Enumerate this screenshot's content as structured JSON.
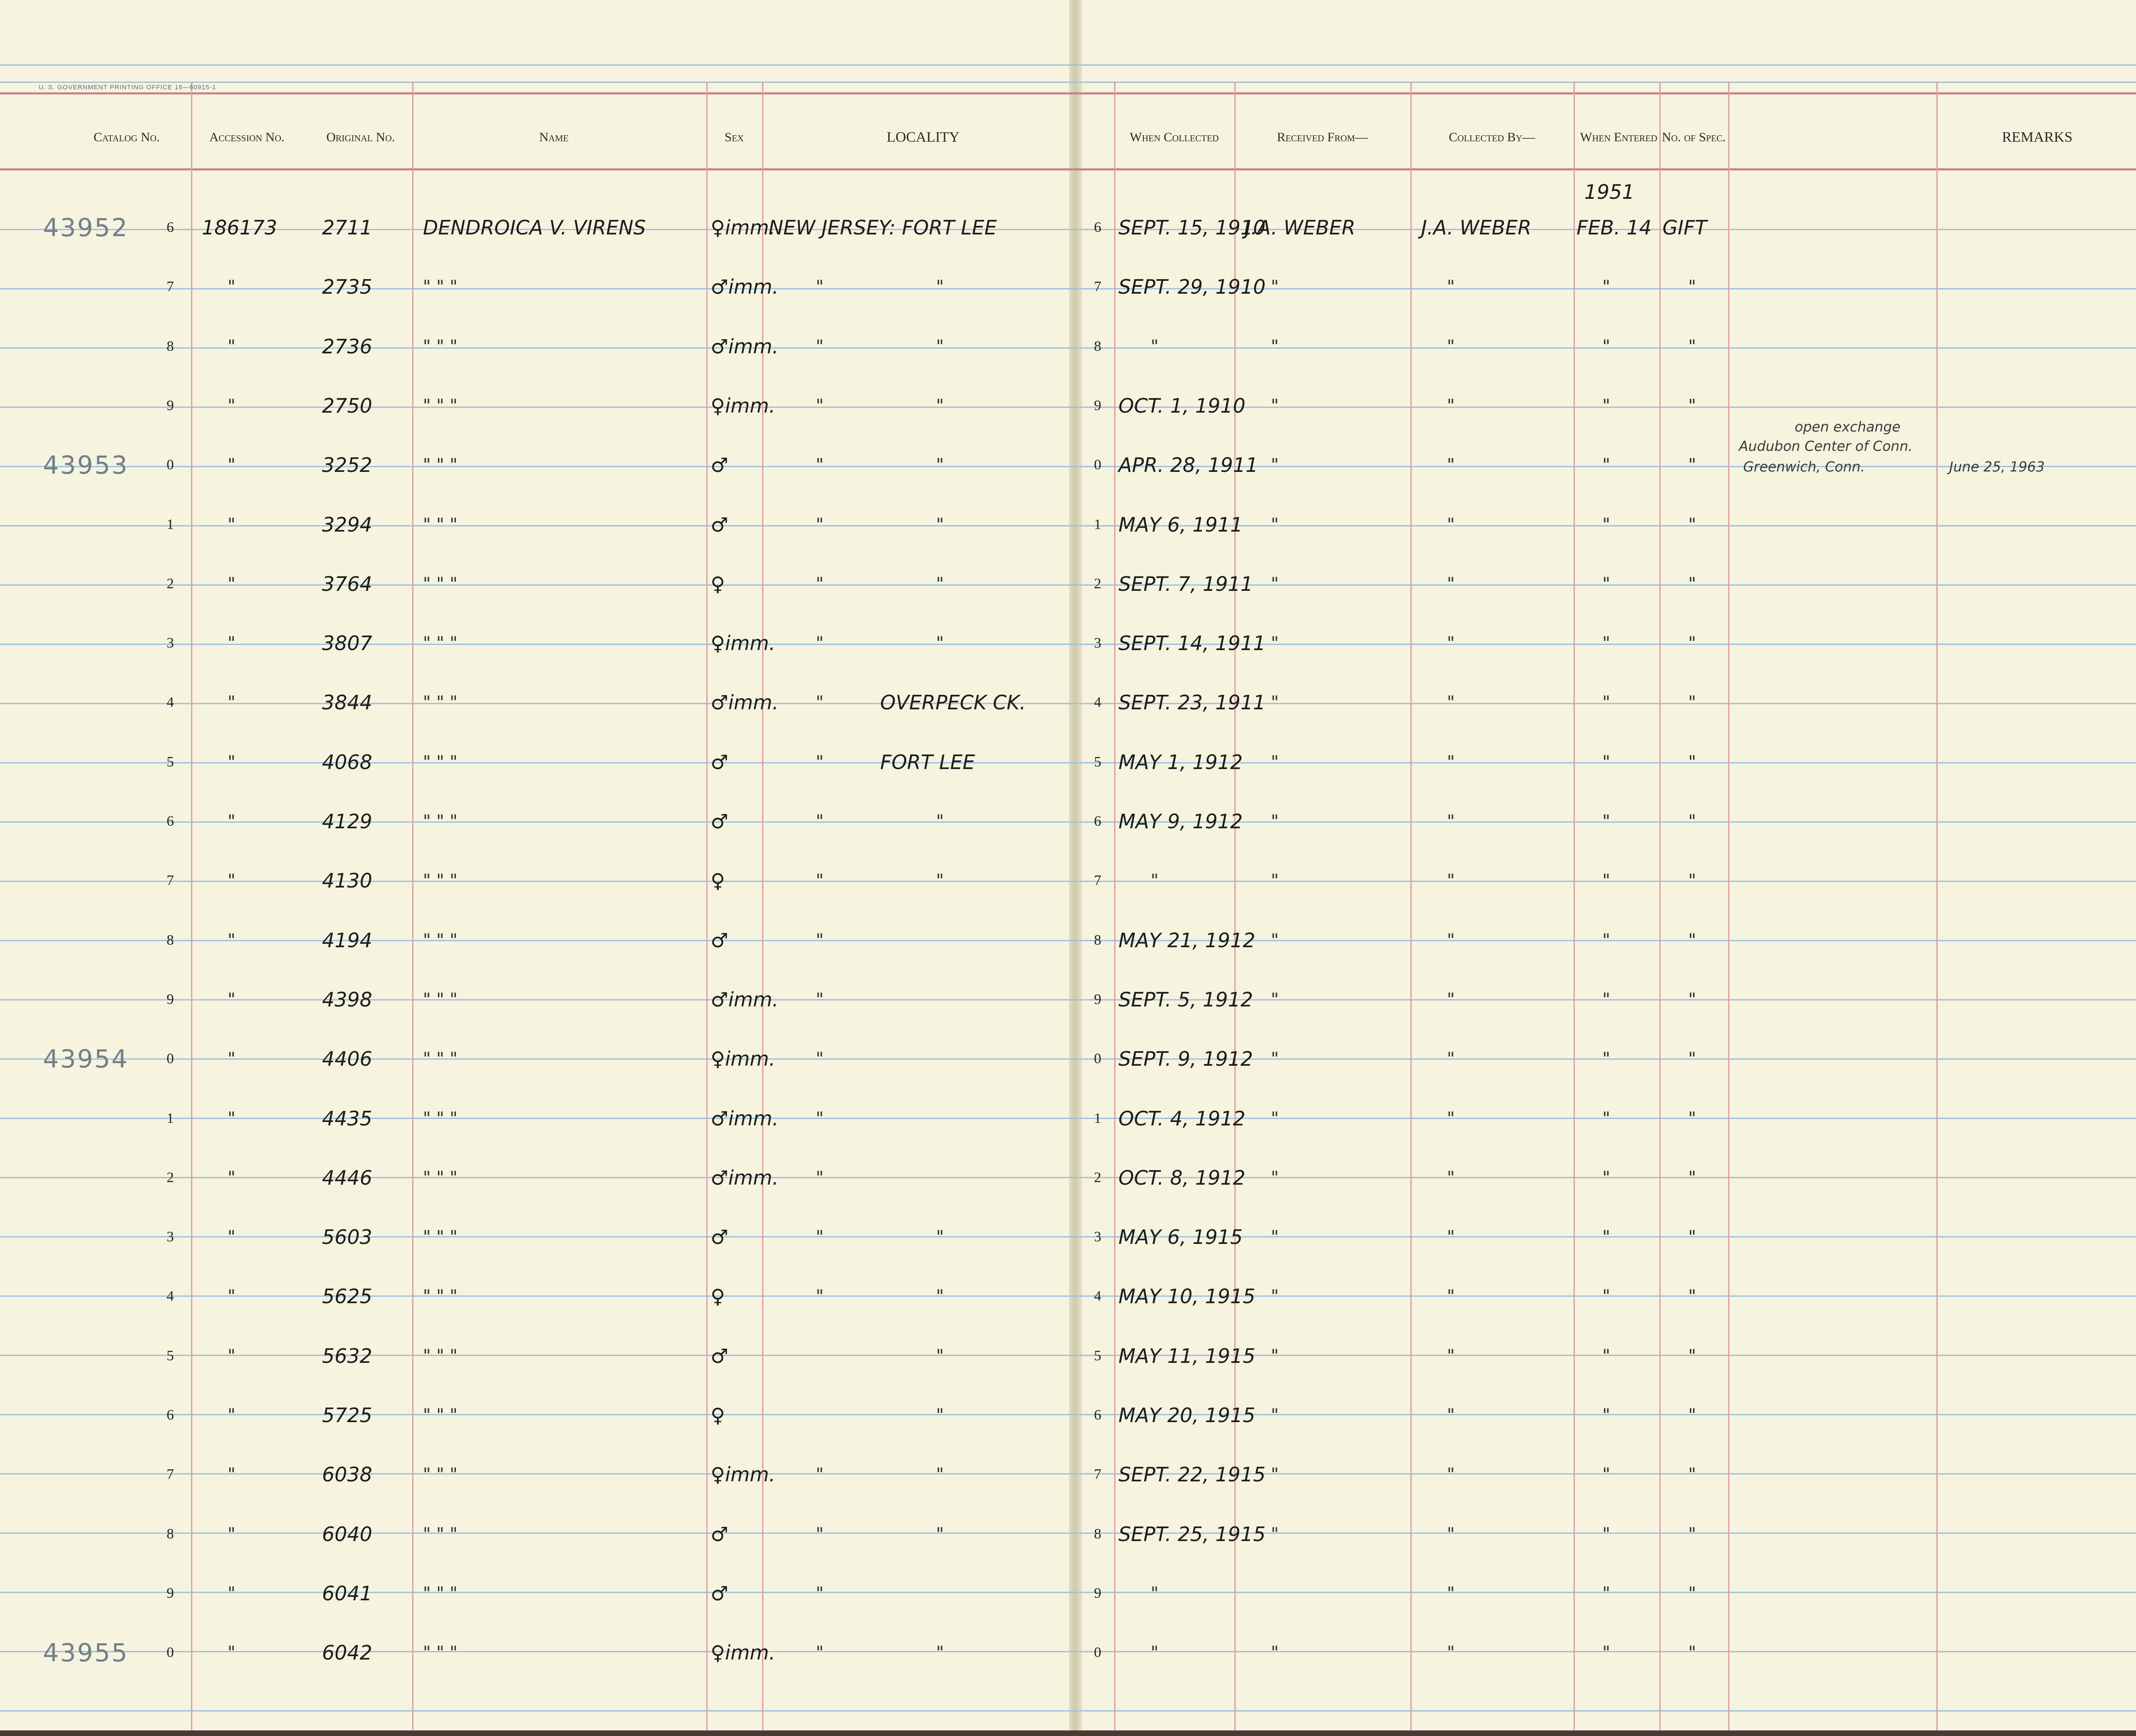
{
  "printer_line": "U. S. GOVERNMENT PRINTING OFFICE    16—60915-1",
  "headers": {
    "catalog_no": "Catalog No.",
    "accession_no": "Accession No.",
    "original_no": "Original No.",
    "name": "Name",
    "sex": "Sex",
    "locality": "LOCALITY",
    "when_collected": "When Collected",
    "received_from": "Received From—",
    "collected_by": "Collected By—",
    "when_entered": "When Entered",
    "no_of_spec": "No. of Spec.",
    "remarks": "REMARKS"
  },
  "year_entered": "1951",
  "catalog_prefixes": [
    {
      "text": "43952",
      "row": 0
    },
    {
      "text": "43953",
      "row": 4
    },
    {
      "text": "43954",
      "row": 14
    },
    {
      "text": "43955",
      "row": 24
    }
  ],
  "rows": [
    {
      "n": "6",
      "acc": "186173",
      "orig": "2711",
      "name": "DENDROICA V. VIRENS",
      "sex": "♀imm.",
      "loc1": "NEW JERSEY: FORT LEE",
      "loc2": "",
      "rn": "6",
      "date": "SEPT. 15, 1910",
      "recv": "J.A. WEBER",
      "coll": "J.A. WEBER",
      "ent": "FEB. 14",
      "spec": "GIFT"
    },
    {
      "n": "7",
      "acc": "\"",
      "orig": "2735",
      "name": "\"   \"   \"",
      "sex": "♂imm.",
      "loc1": "\"",
      "loc2": "\"",
      "rn": "7",
      "date": "SEPT. 29, 1910",
      "recv": "\"",
      "coll": "\"",
      "ent": "\"",
      "spec": "\""
    },
    {
      "n": "8",
      "acc": "\"",
      "orig": "2736",
      "name": "\"   \"   \"",
      "sex": "♂imm.",
      "loc1": "\"",
      "loc2": "\"",
      "rn": "8",
      "date": "\"",
      "recv": "\"",
      "coll": "\"",
      "ent": "\"",
      "spec": "\""
    },
    {
      "n": "9",
      "acc": "\"",
      "orig": "2750",
      "name": "\"   \"   \"",
      "sex": "♀imm.",
      "loc1": "\"",
      "loc2": "\"",
      "rn": "9",
      "date": "OCT. 1, 1910",
      "recv": "\"",
      "coll": "\"",
      "ent": "\"",
      "spec": "\""
    },
    {
      "n": "0",
      "acc": "\"",
      "orig": "3252",
      "name": "\"   \"   \"",
      "sex": "♂",
      "loc1": "\"",
      "loc2": "\"",
      "rn": "0",
      "date": "APR. 28, 1911",
      "recv": "\"",
      "coll": "\"",
      "ent": "\"",
      "spec": "\""
    },
    {
      "n": "1",
      "acc": "\"",
      "orig": "3294",
      "name": "\"   \"   \"",
      "sex": "♂",
      "loc1": "\"",
      "loc2": "\"",
      "rn": "1",
      "date": "MAY 6, 1911",
      "recv": "\"",
      "coll": "\"",
      "ent": "\"",
      "spec": "\""
    },
    {
      "n": "2",
      "acc": "\"",
      "orig": "3764",
      "name": "\"   \"   \"",
      "sex": "♀",
      "loc1": "\"",
      "loc2": "\"",
      "rn": "2",
      "date": "SEPT. 7, 1911",
      "recv": "\"",
      "coll": "\"",
      "ent": "\"",
      "spec": "\""
    },
    {
      "n": "3",
      "acc": "\"",
      "orig": "3807",
      "name": "\"   \"   \"",
      "sex": "♀imm.",
      "loc1": "\"",
      "loc2": "\"",
      "rn": "3",
      "date": "SEPT. 14, 1911",
      "recv": "\"",
      "coll": "\"",
      "ent": "\"",
      "spec": "\""
    },
    {
      "n": "4",
      "acc": "\"",
      "orig": "3844",
      "name": "\"   \"   \"",
      "sex": "♂imm.",
      "loc1": "\"",
      "loc2": "OVERPECK CK.",
      "rn": "4",
      "date": "SEPT. 23, 1911",
      "recv": "\"",
      "coll": "\"",
      "ent": "\"",
      "spec": "\""
    },
    {
      "n": "5",
      "acc": "\"",
      "orig": "4068",
      "name": "\"   \"   \"",
      "sex": "♂",
      "loc1": "\"",
      "loc2": "FORT LEE",
      "rn": "5",
      "date": "MAY 1, 1912",
      "recv": "\"",
      "coll": "\"",
      "ent": "\"",
      "spec": "\""
    },
    {
      "n": "6",
      "acc": "\"",
      "orig": "4129",
      "name": "\"   \"   \"",
      "sex": "♂",
      "loc1": "\"",
      "loc2": "\"",
      "rn": "6",
      "date": "MAY 9, 1912",
      "recv": "\"",
      "coll": "\"",
      "ent": "\"",
      "spec": "\""
    },
    {
      "n": "7",
      "acc": "\"",
      "orig": "4130",
      "name": "\"   \"   \"",
      "sex": "♀",
      "loc1": "\"",
      "loc2": "\"",
      "rn": "7",
      "date": "\"",
      "recv": "\"",
      "coll": "\"",
      "ent": "\"",
      "spec": "\""
    },
    {
      "n": "8",
      "acc": "\"",
      "orig": "4194",
      "name": "\"   \"   \"",
      "sex": "♂",
      "loc1": "\"",
      "loc2": "",
      "rn": "8",
      "date": "MAY 21, 1912",
      "recv": "\"",
      "coll": "\"",
      "ent": "\"",
      "spec": "\""
    },
    {
      "n": "9",
      "acc": "\"",
      "orig": "4398",
      "name": "\"   \"   \"",
      "sex": "♂imm.",
      "loc1": "\"",
      "loc2": "",
      "rn": "9",
      "date": "SEPT. 5, 1912",
      "recv": "\"",
      "coll": "\"",
      "ent": "\"",
      "spec": "\""
    },
    {
      "n": "0",
      "acc": "\"",
      "orig": "4406",
      "name": "\"   \"   \"",
      "sex": "♀imm.",
      "loc1": "\"",
      "loc2": "",
      "rn": "0",
      "date": "SEPT. 9, 1912",
      "recv": "\"",
      "coll": "\"",
      "ent": "\"",
      "spec": "\""
    },
    {
      "n": "1",
      "acc": "\"",
      "orig": "4435",
      "name": "\"   \"   \"",
      "sex": "♂imm.",
      "loc1": "\"",
      "loc2": "",
      "rn": "1",
      "date": "OCT. 4, 1912",
      "recv": "\"",
      "coll": "\"",
      "ent": "\"",
      "spec": "\""
    },
    {
      "n": "2",
      "acc": "\"",
      "orig": "4446",
      "name": "\"   \"   \"",
      "sex": "♂imm.",
      "loc1": "\"",
      "loc2": "",
      "rn": "2",
      "date": "OCT. 8, 1912",
      "recv": "\"",
      "coll": "\"",
      "ent": "\"",
      "spec": "\""
    },
    {
      "n": "3",
      "acc": "\"",
      "orig": "5603",
      "name": "\"   \"   \"",
      "sex": "♂",
      "loc1": "\"",
      "loc2": "\"",
      "rn": "3",
      "date": "MAY 6, 1915",
      "recv": "\"",
      "coll": "\"",
      "ent": "\"",
      "spec": "\""
    },
    {
      "n": "4",
      "acc": "\"",
      "orig": "5625",
      "name": "\"   \"   \"",
      "sex": "♀",
      "loc1": "\"",
      "loc2": "\"",
      "rn": "4",
      "date": "MAY 10, 1915",
      "recv": "\"",
      "coll": "\"",
      "ent": "\"",
      "spec": "\""
    },
    {
      "n": "5",
      "acc": "\"",
      "orig": "5632",
      "name": "\"   \"   \"",
      "sex": "♂",
      "loc1": "",
      "loc2": "\"",
      "rn": "5",
      "date": "MAY 11, 1915",
      "recv": "\"",
      "coll": "\"",
      "ent": "\"",
      "spec": "\""
    },
    {
      "n": "6",
      "acc": "\"",
      "orig": "5725",
      "name": "\"   \"   \"",
      "sex": "♀",
      "loc1": "",
      "loc2": "\"",
      "rn": "6",
      "date": "MAY 20, 1915",
      "recv": "\"",
      "coll": "\"",
      "ent": "\"",
      "spec": "\""
    },
    {
      "n": "7",
      "acc": "\"",
      "orig": "6038",
      "name": "\"   \"   \"",
      "sex": "♀imm.",
      "loc1": "\"",
      "loc2": "\"",
      "rn": "7",
      "date": "SEPT. 22, 1915",
      "recv": "\"",
      "coll": "\"",
      "ent": "\"",
      "spec": "\""
    },
    {
      "n": "8",
      "acc": "\"",
      "orig": "6040",
      "name": "\"   \"   \"",
      "sex": "♂",
      "loc1": "\"",
      "loc2": "\"",
      "rn": "8",
      "date": "SEPT. 25, 1915",
      "recv": "\"",
      "coll": "\"",
      "ent": "\"",
      "spec": "\""
    },
    {
      "n": "9",
      "acc": "\"",
      "orig": "6041",
      "name": "\"   \"   \"",
      "sex": "♂",
      "loc1": "\"",
      "loc2": "",
      "rn": "9",
      "date": "\"",
      "recv": "",
      "coll": "\"",
      "ent": "\"",
      "spec": "\""
    },
    {
      "n": "0",
      "acc": "\"",
      "orig": "6042",
      "name": "\"   \"   \"",
      "sex": "♀imm.",
      "loc1": "\"",
      "loc2": "\"",
      "rn": "0",
      "date": "\"",
      "recv": "\"",
      "coll": "\"",
      "ent": "\"",
      "spec": "\""
    }
  ],
  "remark_row4": {
    "line1": "open exchange",
    "line2": "Audubon Center of Conn.",
    "line3": "Greenwich, Conn.",
    "date": "June 25, 1963"
  }
}
